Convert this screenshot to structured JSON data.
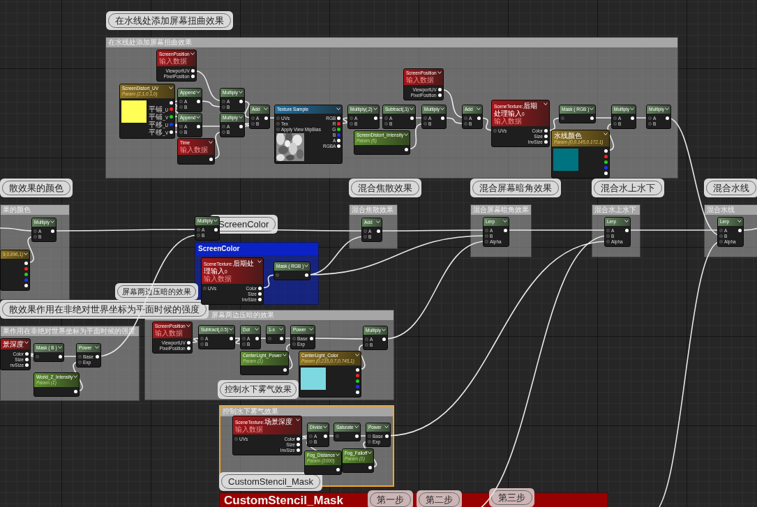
{
  "comments": [
    {
      "title": "在水线处添加屏幕扭曲效果",
      "bubble": "在水线处添加屏幕扭曲效果",
      "selected": false,
      "color": "#a6a6a6"
    },
    {
      "title": "果的颜色",
      "bubble": "散效果的颜色",
      "selected": false,
      "color": "#a6a6a6"
    },
    {
      "title": "ScreenColor",
      "bubble": "ScreenColor",
      "selected": false,
      "color": "#0b22c4"
    },
    {
      "title": "混合焦散效果",
      "bubble": "混合焦散效果",
      "selected": false,
      "color": "#a6a6a6"
    },
    {
      "title": "混合屏幕暗角效果",
      "bubble": "混合屏幕暗角效果",
      "selected": false,
      "color": "#a6a6a6"
    },
    {
      "title": "混合水上水下",
      "bubble": "混合水上水下",
      "selected": false,
      "color": "#a6a6a6"
    },
    {
      "title": "混合水线",
      "bubble": "混合水线",
      "selected": false,
      "color": "#a6a6a6"
    },
    {
      "title": "屏幕两边压暗的效果",
      "bubble": "屏幕两边压暗的效果",
      "selected": false,
      "color": "#a6a6a6"
    },
    {
      "title": "果作用在非绝对世界坐标为平面时候的强度",
      "bubble": "散效果作用在非绝对世界坐标为平面时候的强度",
      "selected": false,
      "color": "#a6a6a6"
    },
    {
      "title": "控制水下雾气效果",
      "bubble": "控制水下雾气效果",
      "selected": true,
      "color": "#a6a6a6"
    },
    {
      "title": "CustomStencil_Mask",
      "bubble": "CustomStencil_Mask",
      "selected": false,
      "color": "#990000"
    }
  ],
  "nodes": [
    {
      "kind": "input",
      "title": "ScreenPosition",
      "subtitle": "输入数据",
      "outputs": [
        "ViewportUV",
        "PixelPosition"
      ]
    },
    {
      "kind": "vector-param",
      "title": "ScreenDistort_UV",
      "subtitle": "Param (2,1,0.1,0)",
      "color": "#ffff55",
      "outputs": [
        "平铺_U",
        "平铺_V",
        "平移_U",
        "平移_V"
      ]
    },
    {
      "kind": "expression",
      "title": "Append",
      "inputs": [
        "A",
        "B"
      ]
    },
    {
      "kind": "expression",
      "title": "Append",
      "inputs": [
        "A",
        "B"
      ]
    },
    {
      "kind": "input",
      "title": "Time",
      "subtitle": "输入数据"
    },
    {
      "kind": "expression",
      "title": "Multiply",
      "inputs": [
        "A",
        "B"
      ]
    },
    {
      "kind": "expression",
      "title": "Multiply",
      "inputs": [
        "A",
        "B"
      ]
    },
    {
      "kind": "expression",
      "title": "Add",
      "inputs": [
        "A",
        "B"
      ]
    },
    {
      "kind": "texture",
      "title": "Texture Sample",
      "inputs": [
        "UVs",
        "Tex",
        "Apply View MipBias"
      ],
      "outputs": [
        "RGB",
        "R",
        "G",
        "B",
        "A",
        "RGBA"
      ]
    },
    {
      "kind": "expression",
      "title": "Multiply(,2)",
      "inputs": [
        "A",
        "B"
      ]
    },
    {
      "kind": "expression",
      "title": "Subtract(,1)",
      "inputs": [
        "A",
        "B"
      ]
    },
    {
      "kind": "param",
      "title": "ScreenDistort_Intensity",
      "subtitle": "Param (5)"
    },
    {
      "kind": "input",
      "title": "ScreenPosition",
      "subtitle": "输入数据",
      "outputs": [
        "ViewportUV",
        "PixelPosition"
      ]
    },
    {
      "kind": "expression",
      "title": "Multiply",
      "inputs": [
        "A",
        "B"
      ]
    },
    {
      "kind": "expression",
      "title": "Add",
      "inputs": [
        "A",
        "B"
      ]
    },
    {
      "kind": "input",
      "title": "SceneTexture:后期处理输入0",
      "subtitle": "输入数据",
      "inputs": [
        "UVs"
      ],
      "outputs": [
        "Color",
        "Size",
        "InvSize"
      ]
    },
    {
      "kind": "expression",
      "title": "Mask ( RGB )",
      "bare_input": true
    },
    {
      "kind": "vector-param",
      "title": "水线颜色",
      "subtitle": "Param (0,0.145,0.172,1)",
      "color": "#007380"
    },
    {
      "kind": "expression",
      "title": "Multiply",
      "inputs": [
        "A",
        "B"
      ]
    },
    {
      "kind": "expression",
      "title": "Multiply",
      "inputs": [
        "A",
        "B"
      ]
    },
    {
      "kind": "expression",
      "title": "Multiply",
      "inputs": [
        "A",
        "B"
      ]
    },
    {
      "kind": "vector-param",
      "subtitle": "9,0.896,1)"
    },
    {
      "kind": "expression",
      "title": "Multiply",
      "inputs": [
        "A",
        "B"
      ]
    },
    {
      "kind": "input",
      "title": "SceneTexture:后期处理输入0",
      "subtitle": "输入数据",
      "inputs": [
        "UVs"
      ],
      "outputs": [
        "Color",
        "Size",
        "InvSize"
      ]
    },
    {
      "kind": "expression",
      "title": "Mask ( RGB )",
      "bare_input": true
    },
    {
      "kind": "expression",
      "title": "Add",
      "inputs": [
        "A",
        "B"
      ]
    },
    {
      "kind": "expression",
      "title": "Lerp",
      "inputs": [
        "A",
        "B",
        "Alpha"
      ]
    },
    {
      "kind": "expression",
      "title": "Lerp",
      "inputs": [
        "A",
        "B",
        "Alpha"
      ]
    },
    {
      "kind": "expression",
      "title": "Lerp",
      "inputs": [
        "A",
        "B",
        "Alpha"
      ]
    },
    {
      "kind": "input",
      "title": "景深度",
      "outputs": [
        "Color",
        "Size",
        "nvSize"
      ]
    },
    {
      "kind": "expression",
      "title": "Mask ( B )",
      "bare_input": true
    },
    {
      "kind": "expression",
      "title": "Power",
      "inputs": [
        "Base",
        "Exp"
      ]
    },
    {
      "kind": "param",
      "title": "World_Z_Intensity",
      "subtitle": "Param (1)"
    },
    {
      "kind": "input",
      "title": "ScreenPosition",
      "subtitle": "输入数据",
      "outputs": [
        "ViewportUV",
        "PixelPosition"
      ]
    },
    {
      "kind": "expression",
      "title": "Subtract(,0.5)",
      "inputs": [
        "A",
        "B"
      ]
    },
    {
      "kind": "expression",
      "title": "Dot",
      "inputs": [
        "A",
        "B"
      ]
    },
    {
      "kind": "expression",
      "title": "1-x",
      "bare_input": true
    },
    {
      "kind": "expression",
      "title": "Power",
      "inputs": [
        "Base",
        "Exp"
      ]
    },
    {
      "kind": "param",
      "title": "CenterLight_Power",
      "subtitle": "Param (1)"
    },
    {
      "kind": "vector-param",
      "title": "CenterLight_Color",
      "subtitle": "Param (0.215,0.7,0.745,1)",
      "color": "#7dd8df"
    },
    {
      "kind": "expression",
      "title": "Multiply",
      "inputs": [
        "A",
        "B"
      ]
    },
    {
      "kind": "input",
      "title": "SceneTexture:场景深度",
      "subtitle": "输入数据",
      "inputs": [
        "UVs"
      ],
      "outputs": [
        "Color",
        "Size",
        "InvSize"
      ]
    },
    {
      "kind": "expression",
      "title": "Divide",
      "inputs": [
        "A",
        "B"
      ]
    },
    {
      "kind": "expression",
      "title": "Saturate",
      "bare_input": true
    },
    {
      "kind": "expression",
      "title": "Power",
      "inputs": [
        "Base",
        "Exp"
      ]
    },
    {
      "kind": "param",
      "title": "Fog_Distance",
      "subtitle": "Param (1000)"
    },
    {
      "kind": "param",
      "title": "Fog_Falloff",
      "subtitle": "Param (1)"
    }
  ],
  "notes": [
    "第一步",
    "第二步",
    "第三步"
  ]
}
